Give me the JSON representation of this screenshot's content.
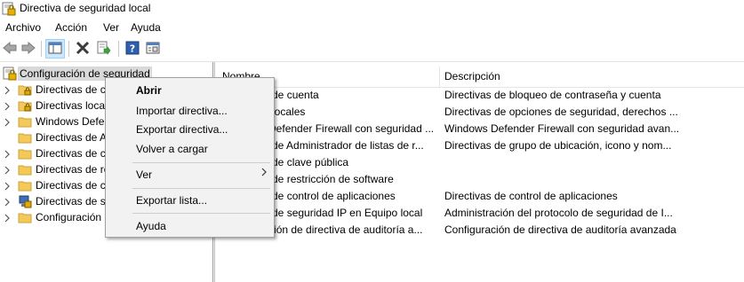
{
  "window": {
    "title": "Directiva de seguridad local"
  },
  "menubar": {
    "items": [
      "Archivo",
      "Acción",
      "Ver",
      "Ayuda"
    ]
  },
  "toolbar": {
    "buttons": [
      "back-icon",
      "forward-icon",
      "show-hide-tree-icon",
      "delete-icon",
      "export-list-icon",
      "help-icon",
      "properties-icon"
    ]
  },
  "tree": {
    "root": "Configuración de seguridad",
    "items": [
      {
        "label": "Directivas de c",
        "icon": "folder-lock-icon"
      },
      {
        "label": "Directivas local",
        "icon": "folder-lock-icon"
      },
      {
        "label": "Windows Defen",
        "icon": "folder-icon"
      },
      {
        "label": "Directivas de A",
        "icon": "folder-icon"
      },
      {
        "label": "Directivas de cl",
        "icon": "folder-icon"
      },
      {
        "label": "Directivas de re",
        "icon": "folder-icon"
      },
      {
        "label": "Directivas de co",
        "icon": "folder-icon"
      },
      {
        "label": "Directivas de se",
        "icon": "ipsec-icon"
      },
      {
        "label": "Configuración",
        "icon": "folder-icon"
      }
    ]
  },
  "list": {
    "columns": [
      "Nombre",
      "Descripción"
    ],
    "rows": [
      {
        "name": "Directivas de cuenta",
        "description": "Directivas de bloqueo de contraseña y cuenta"
      },
      {
        "name": "Directivas locales",
        "description": "Directivas de opciones de seguridad, derechos ..."
      },
      {
        "name": "Windows Defender Firewall con seguridad ...",
        "description": "Windows Defender Firewall con seguridad avan..."
      },
      {
        "name": "Directivas de Administrador de listas de r...",
        "description": "Directivas de grupo de ubicación, icono y nom..."
      },
      {
        "name": "Directivas de clave pública",
        "description": ""
      },
      {
        "name": "Directivas de restricción de software",
        "description": ""
      },
      {
        "name": "Directivas de control de aplicaciones",
        "description": "Directivas de control de aplicaciones"
      },
      {
        "name": "Directivas de seguridad IP en Equipo local",
        "description": "Administración del protocolo de seguridad de I..."
      },
      {
        "name": "Configuración de directiva de auditoría a...",
        "description": "Configuración de directiva de auditoría avanzada"
      }
    ]
  },
  "context_menu": {
    "items": [
      "Abrir",
      "Importar directiva...",
      "Exportar directiva...",
      "Volver a cargar",
      "Ver",
      "Exportar lista...",
      "Ayuda"
    ]
  }
}
